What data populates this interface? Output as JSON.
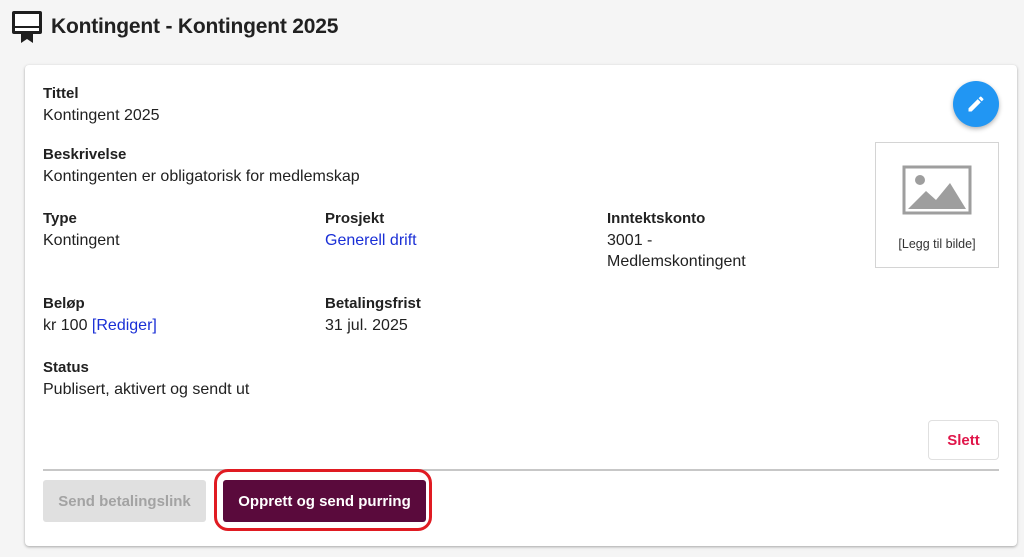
{
  "header": {
    "icon": "certificate-badge-icon",
    "title": "Kontingent - Kontingent 2025"
  },
  "details": {
    "title_label": "Tittel",
    "title_value": "Kontingent 2025",
    "description_label": "Beskrivelse",
    "description_value": "Kontingenten er obligatorisk for medlemskap",
    "type_label": "Type",
    "type_value": "Kontingent",
    "project_label": "Prosjekt",
    "project_value": "Generell drift",
    "account_label": "Inntektskonto",
    "account_value_line1": "3001 -",
    "account_value_line2": "Medlemskontingent",
    "amount_label": "Beløp",
    "amount_value": "kr 100",
    "amount_edit_link": "[Rediger]",
    "due_label": "Betalingsfrist",
    "due_value": "31 jul. 2025",
    "status_label": "Status",
    "status_value": "Publisert, aktivert og sendt ut"
  },
  "image": {
    "icon": "image-placeholder-icon",
    "caption": "[Legg til bilde]"
  },
  "actions": {
    "edit_icon": "pencil-icon",
    "delete_label": "Slett",
    "send_payment_link_label": "Send betalingslink",
    "send_reminder_label": "Opprett og send purring"
  },
  "colors": {
    "fab": "#2196f3",
    "link": "#1a2fd6",
    "delete": "#e0164a",
    "primary_button": "#5a0a3c",
    "highlight": "#e01b22"
  }
}
